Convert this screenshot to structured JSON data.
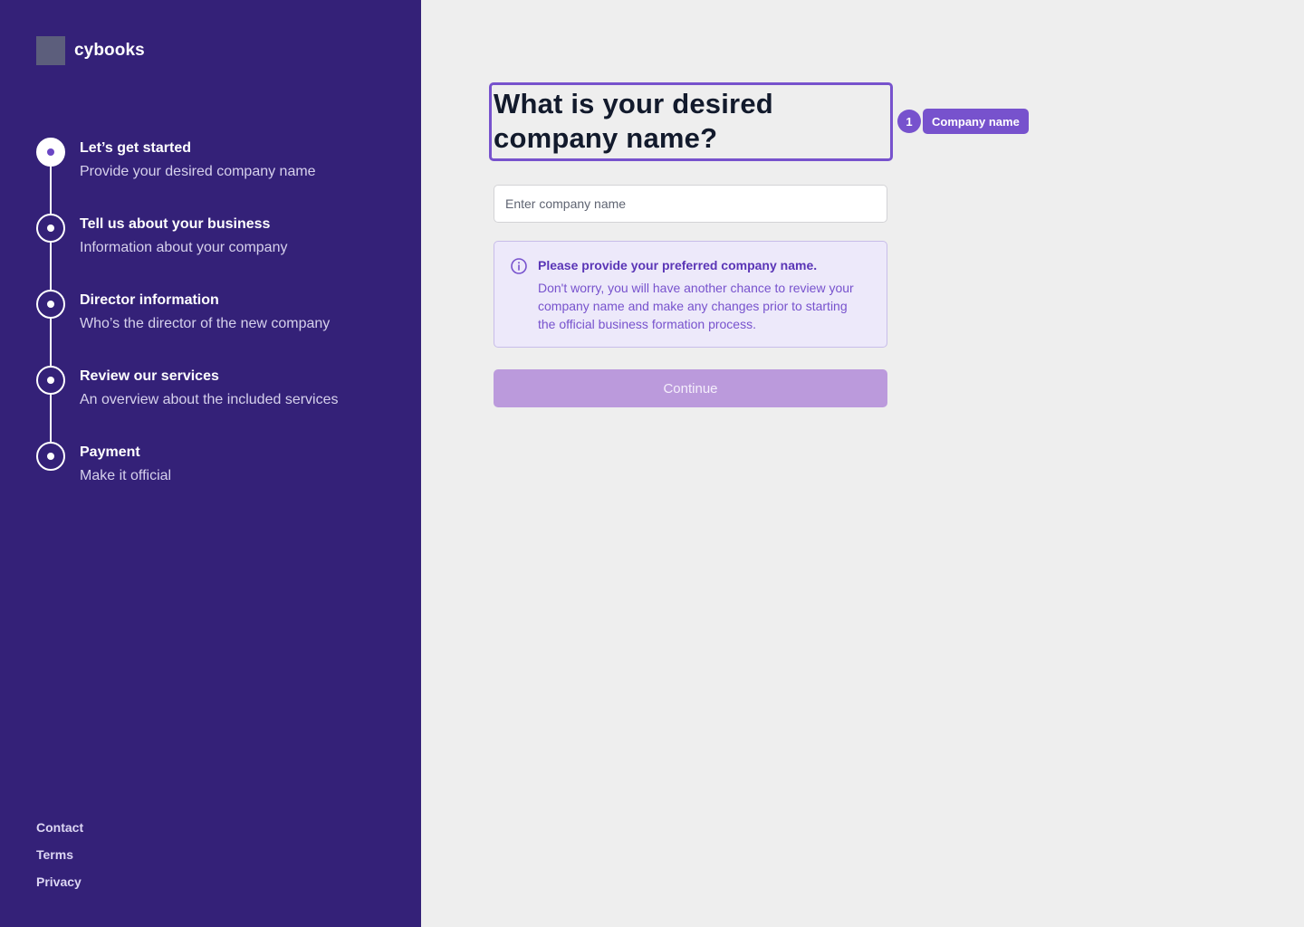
{
  "brand": {
    "name": "cybooks"
  },
  "steps": [
    {
      "title": "Let’s get started",
      "subtitle": "Provide your desired company name",
      "state": "active"
    },
    {
      "title": "Tell us about your business",
      "subtitle": "Information about your company",
      "state": "pending"
    },
    {
      "title": "Director information",
      "subtitle": "Who’s the director of the new company",
      "state": "pending"
    },
    {
      "title": "Review our services",
      "subtitle": "An overview about the included services",
      "state": "pending"
    },
    {
      "title": "Payment",
      "subtitle": "Make it official",
      "state": "pending"
    }
  ],
  "footer": {
    "links": [
      "Contact",
      "Terms",
      "Privacy"
    ]
  },
  "main": {
    "heading": "What is your desired company name?",
    "annotation": {
      "number": "1",
      "label": "Company name"
    },
    "input": {
      "placeholder": "Enter company name",
      "value": ""
    },
    "info": {
      "icon": "info-icon",
      "title": "Please provide your preferred company name.",
      "text": "Don't worry, you will have another chance to review your company name and make any changes prior to starting the official business formation process."
    },
    "continue_label": "Continue"
  },
  "colors": {
    "sidebar_bg": "#342178",
    "accent": "#7752cd",
    "button_disabled": "#bb9adc",
    "page_bg": "#eeeeee"
  }
}
